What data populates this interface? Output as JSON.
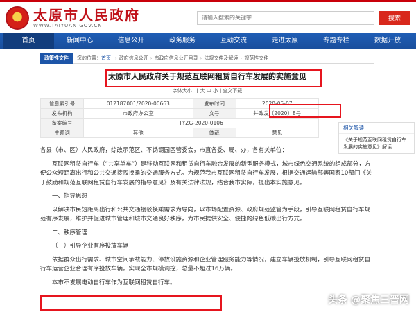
{
  "header": {
    "logo_cn": "太原市人民政府",
    "logo_en": "WWW.TAIYUAN.GOV.CN",
    "search_placeholder": "请输入搜索的关键字",
    "search_button": "搜索"
  },
  "nav": [
    "首页",
    "新闻中心",
    "信息公开",
    "政务服务",
    "互动交流",
    "走进太原",
    "专题专栏",
    "数据开放"
  ],
  "breadcrumb": {
    "tag": "政策性文件",
    "items": [
      "您的位置：",
      "首页",
      "政府信息公开",
      "市政府信息公开目录",
      "法规文件及解读",
      "规范性文件"
    ]
  },
  "doc": {
    "title": "太原市人民政府关于规范互联网租赁自行车发展的实施意见",
    "font_size_bar": "字体大小：[ 大  中  小 ]  全文下载"
  },
  "meta": {
    "rows": [
      [
        "信息索引号",
        "012187001/2020-00663",
        "发布时间",
        "2020-05-07"
      ],
      [
        "发布机构",
        "市政府办公室",
        "文号",
        "并政发〔2020〕8号"
      ],
      [
        "备案编号",
        "TYZG-2020-0106",
        "",
        ""
      ],
      [
        "主题词",
        "其他",
        "体裁",
        "意见"
      ]
    ]
  },
  "side": {
    "head": "相关解读",
    "item": "《关于规范互联网租赁自行车发展的实施意见》解读"
  },
  "body": {
    "p1": "各县（市、区）人民政府，综改示范区、不锈钢园区管委会，市直各委、局、办，各有关单位：",
    "p2": "互联网租赁自行车（“共享单车”）是移动互联网和租赁自行车融合发展的新型服务模式，城市绿色交通系统的组成部分，方便公众短距离出行和公共交通接驳换乘的交通服务方式。为规范我市互联网租赁自行车发展，根据交通运输部等国家10部门《关于鼓励和规范互联网租赁自行车发展的指导意见》及有关法律法规，结合我市实际，提出本实施意见。",
    "h1": "一、指导思想",
    "p3": "以解决市民短距离出行和公共交通接驳换乘需求为导向，以市场配置资源、政府规范监管为手段，引导互联网租赁自行车规范有序发展，维护并促进城市管理和城市交通良好秩序，为市民提供安全、便捷的绿色低碳出行方式。",
    "h2": "二、秩序管理",
    "h3": "（一）引导企业有序投放车辆",
    "p4": "依据群众出行需求、城市空间承载能力、停放设施资源和企业管理服务能力等情况，建立车辆投放机制，引导互联网租赁自行车运营企业合理有序投放车辆。实现全市规模调控，总量不超过16万辆。",
    "p5": "本市不发展电动自行车作为互联网租赁自行车。"
  },
  "watermark": "头条 @聚焦三晋网",
  "colors": {
    "brand_red": "#c0121a",
    "nav_blue": "#1a4f9d",
    "highlight_red": "#e6151e"
  }
}
